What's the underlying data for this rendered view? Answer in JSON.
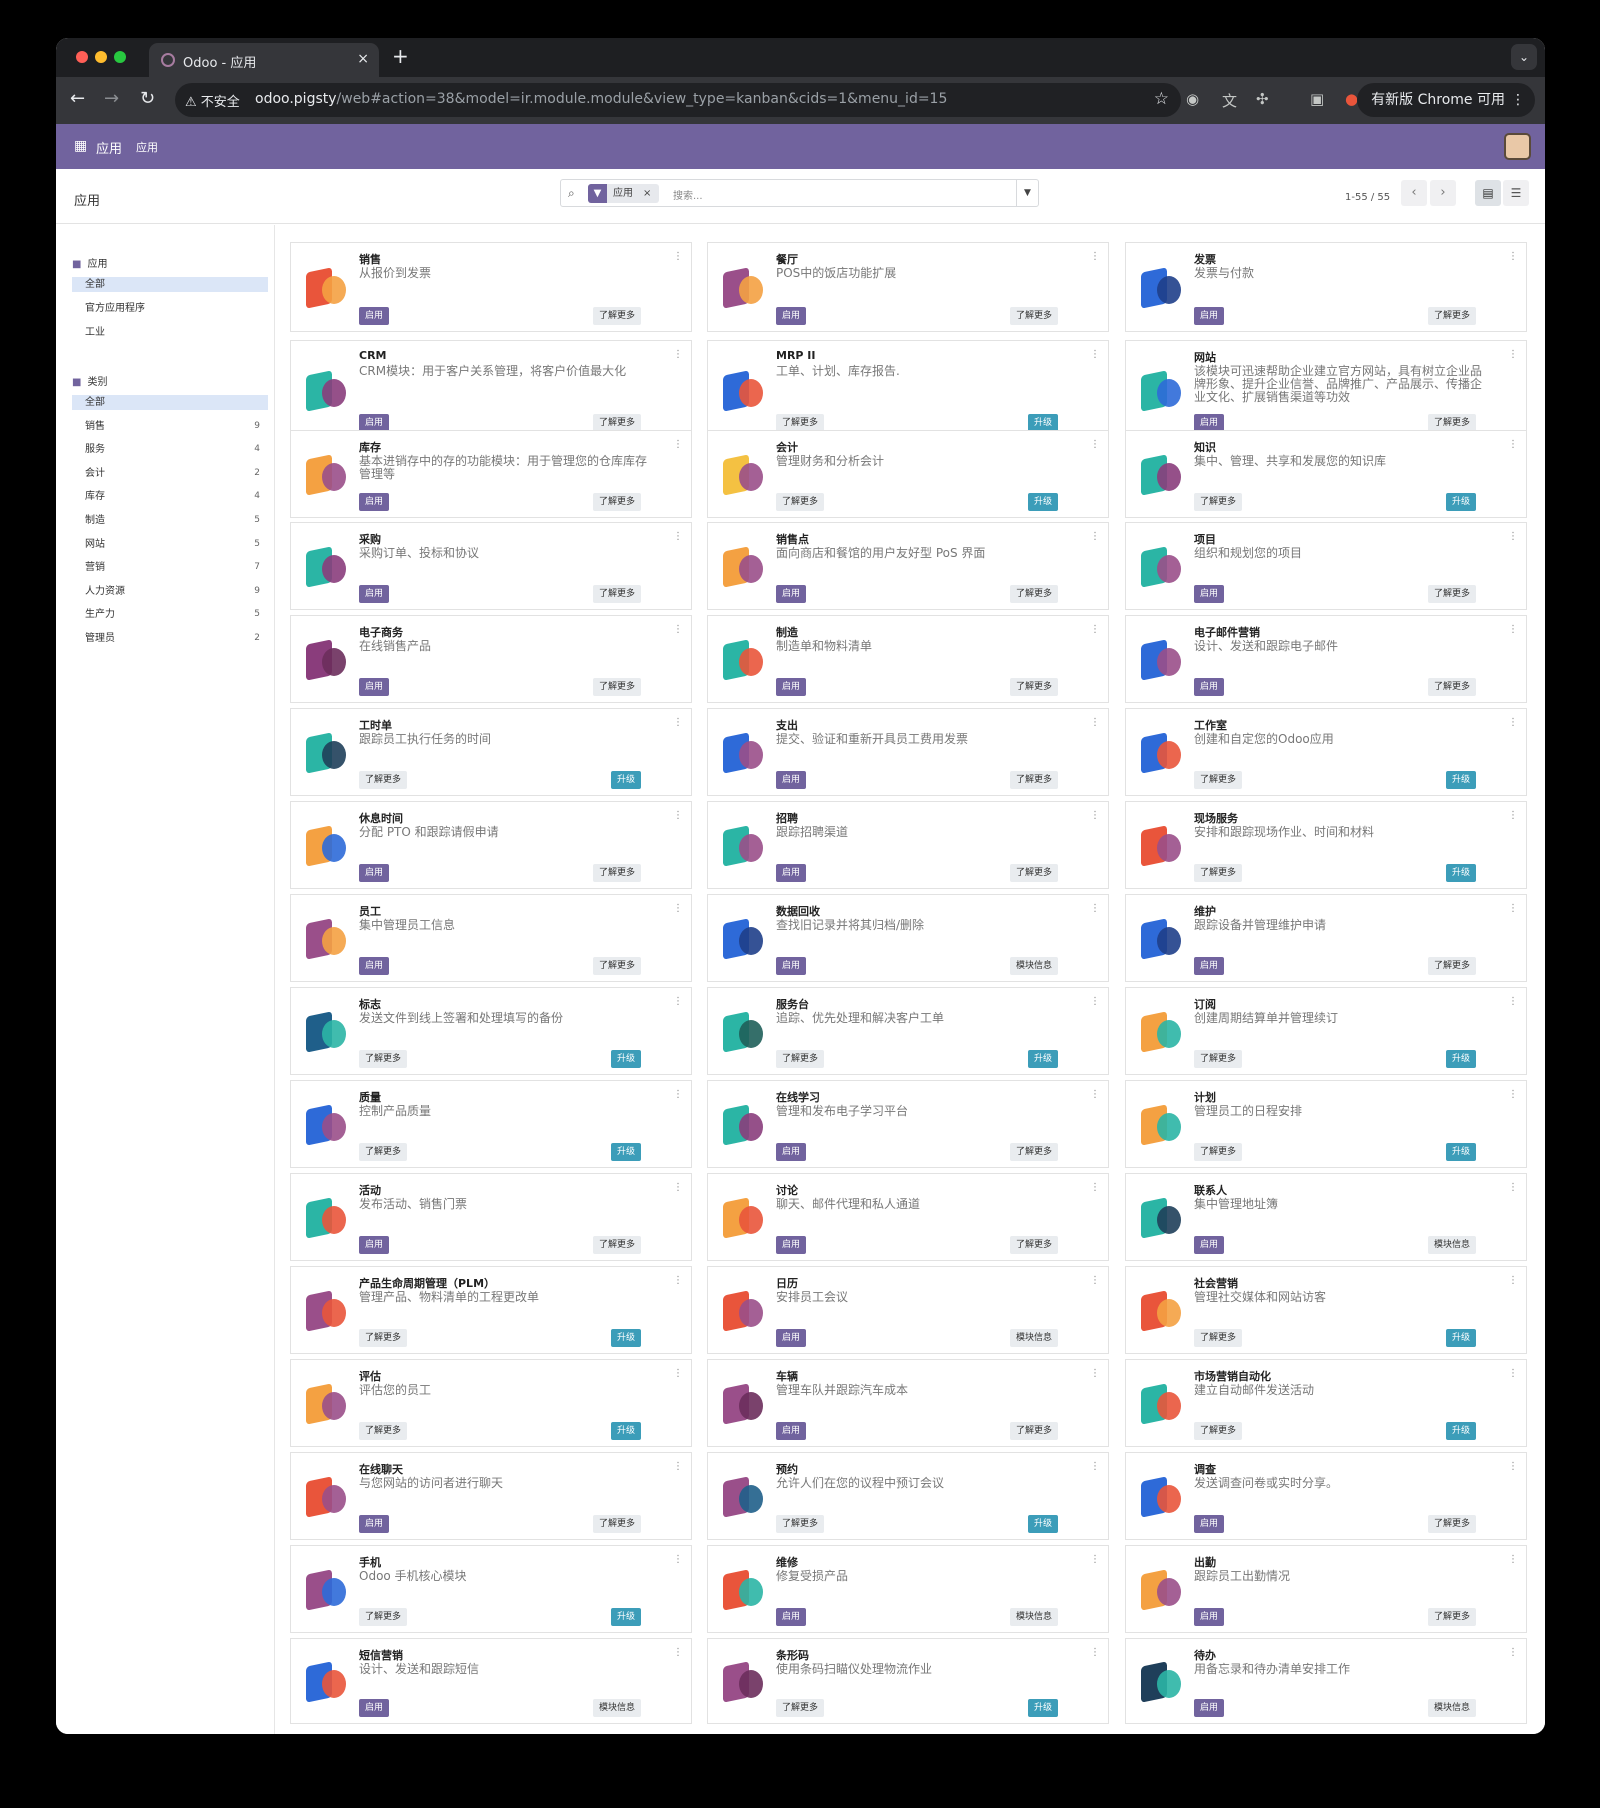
{
  "browser": {
    "tab_title": "Odoo - 应用",
    "tab_close": "×",
    "new_tab": "+",
    "security": "⚠ 不安全",
    "url_host": "odoo.pigsty",
    "url_path": "/web#action=38&model=ir.module.module&view_type=kanban&cids=1&menu_id=15",
    "update_label": "有新版 Chrome 可用",
    "colors": {
      "close": "#ff5f57",
      "min": "#febc2e",
      "max": "#28c840"
    }
  },
  "odoo_nav": {
    "brand": "应用",
    "menu": "应用"
  },
  "control_panel": {
    "title": "应用",
    "facet": "应用",
    "facet_close": "×",
    "search_placeholder": "搜索...",
    "pager": "1-55 / 55"
  },
  "sidebar": {
    "section1": "应用",
    "apps": [
      {
        "label": "全部",
        "selected": true
      },
      {
        "label": "官方应用程序",
        "selected": false
      },
      {
        "label": "工业",
        "selected": false
      }
    ],
    "section2": "类别",
    "categories": [
      {
        "label": "全部",
        "count": "",
        "selected": true
      },
      {
        "label": "销售",
        "count": "9"
      },
      {
        "label": "服务",
        "count": "4"
      },
      {
        "label": "会计",
        "count": "2"
      },
      {
        "label": "库存",
        "count": "4"
      },
      {
        "label": "制造",
        "count": "5"
      },
      {
        "label": "网站",
        "count": "5"
      },
      {
        "label": "营销",
        "count": "7"
      },
      {
        "label": "人力资源",
        "count": "9"
      },
      {
        "label": "生产力",
        "count": "5"
      },
      {
        "label": "管理员",
        "count": "2"
      }
    ]
  },
  "labels": {
    "activate": "启用",
    "learn": "了解更多",
    "upgrade": "升级",
    "info": "模块信息"
  },
  "apps": [
    {
      "name": "销售",
      "desc": "从报价到发票",
      "b1": "activate",
      "b2": "learn",
      "icon": "sales-icon",
      "c1": "#e9553b",
      "c2": "#f4a142"
    },
    {
      "name": "餐厅",
      "desc": "POS中的饭店功能扩展",
      "b1": "activate",
      "b2": "learn",
      "icon": "restaurant-icon",
      "c1": "#9a4f8a",
      "c2": "#f4a142"
    },
    {
      "name": "发票",
      "desc": "发票与付款",
      "b1": "activate",
      "b2": "learn",
      "icon": "invoicing-icon",
      "c1": "#2e6ad8",
      "c2": "#1f3f8a"
    },
    {
      "name": "CRM",
      "desc": "CRM模块：用于客户关系管理，将客户价值最大化",
      "b1": "activate",
      "b2": "learn",
      "icon": "crm-icon",
      "c1": "#2bb5a5",
      "c2": "#8a3d7c"
    },
    {
      "name": "MRP II",
      "desc": "工单、计划、库存报告.",
      "b1": "learn",
      "b2": "upgrade",
      "icon": "mrp-icon",
      "c1": "#2e6ad8",
      "c2": "#e9553b"
    },
    {
      "name": "网站",
      "desc": "该模块可迅速帮助企业建立官方网站，具有树立企业品牌形象、提升企业信誉、品牌推广、产品展示、传播企业文化、扩展销售渠道等功效",
      "b1": "activate",
      "b2": "learn",
      "icon": "website-icon",
      "c1": "#2bb5a5",
      "c2": "#2e6ad8"
    },
    {
      "name": "库存",
      "desc": "基本进销存中的存的功能模块：用于管理您的仓库库存管理等",
      "b1": "activate",
      "b2": "learn",
      "icon": "inventory-icon",
      "c1": "#f4a142",
      "c2": "#9a4f8a"
    },
    {
      "name": "会计",
      "desc": "管理财务和分析会计",
      "b1": "learn",
      "b2": "upgrade",
      "icon": "accounting-icon",
      "c1": "#f4c142",
      "c2": "#9a4f8a"
    },
    {
      "name": "知识",
      "desc": "集中、管理、共享和发展您的知识库",
      "b1": "learn",
      "b2": "upgrade",
      "icon": "knowledge-icon",
      "c1": "#2bb5a5",
      "c2": "#8a3d7c"
    },
    {
      "name": "采购",
      "desc": "采购订单、投标和协议",
      "b1": "activate",
      "b2": "learn",
      "icon": "purchase-icon",
      "c1": "#2bb5a5",
      "c2": "#8a3d7c"
    },
    {
      "name": "销售点",
      "desc": "面向商店和餐馆的用户友好型 PoS 界面",
      "b1": "activate",
      "b2": "learn",
      "icon": "pos-icon",
      "c1": "#f4a142",
      "c2": "#9a4f8a"
    },
    {
      "name": "项目",
      "desc": "组织和规划您的项目",
      "b1": "activate",
      "b2": "learn",
      "icon": "project-icon",
      "c1": "#2bb5a5",
      "c2": "#9a4f8a"
    },
    {
      "name": "电子商务",
      "desc": "在线销售产品",
      "b1": "activate",
      "b2": "learn",
      "icon": "ecommerce-icon",
      "c1": "#8a3d7c",
      "c2": "#6b2d5c"
    },
    {
      "name": "制造",
      "desc": "制造单和物料清单",
      "b1": "activate",
      "b2": "learn",
      "icon": "manufacturing-icon",
      "c1": "#2bb5a5",
      "c2": "#e9553b"
    },
    {
      "name": "电子邮件营销",
      "desc": "设计、发送和跟踪电子邮件",
      "b1": "activate",
      "b2": "learn",
      "icon": "email-marketing-icon",
      "c1": "#2e6ad8",
      "c2": "#9a4f8a"
    },
    {
      "name": "工时单",
      "desc": "跟踪员工执行任务的时间",
      "b1": "learn",
      "b2": "upgrade",
      "icon": "timesheet-icon",
      "c1": "#2bb5a5",
      "c2": "#1f3f5a"
    },
    {
      "name": "支出",
      "desc": "提交、验证和重新开具员工费用发票",
      "b1": "activate",
      "b2": "learn",
      "icon": "expenses-icon",
      "c1": "#2e6ad8",
      "c2": "#9a4f8a"
    },
    {
      "name": "工作室",
      "desc": "创建和自定您的Odoo应用",
      "b1": "learn",
      "b2": "upgrade",
      "icon": "studio-icon",
      "c1": "#2e6ad8",
      "c2": "#e9553b"
    },
    {
      "name": "休息时间",
      "desc": "分配 PTO 和跟踪请假申请",
      "b1": "activate",
      "b2": "learn",
      "icon": "time-off-icon",
      "c1": "#f4a142",
      "c2": "#2e6ad8"
    },
    {
      "name": "招聘",
      "desc": "跟踪招聘渠道",
      "b1": "activate",
      "b2": "learn",
      "icon": "recruitment-icon",
      "c1": "#2bb5a5",
      "c2": "#9a4f8a"
    },
    {
      "name": "现场服务",
      "desc": "安排和跟踪现场作业、时间和材料",
      "b1": "learn",
      "b2": "upgrade",
      "icon": "field-service-icon",
      "c1": "#e9553b",
      "c2": "#9a4f8a"
    },
    {
      "name": "员工",
      "desc": "集中管理员工信息",
      "b1": "activate",
      "b2": "learn",
      "icon": "employees-icon",
      "c1": "#9a4f8a",
      "c2": "#f4a142"
    },
    {
      "name": "数据回收",
      "desc": "查找旧记录并将其归档/删除",
      "b1": "activate",
      "b2": "info",
      "icon": "data-recycle-icon",
      "c1": "#2e6ad8",
      "c2": "#1f3f8a"
    },
    {
      "name": "维护",
      "desc": "跟踪设备并管理维护申请",
      "b1": "activate",
      "b2": "learn",
      "icon": "maintenance-icon",
      "c1": "#2e6ad8",
      "c2": "#1f3f8a"
    },
    {
      "name": "标志",
      "desc": "发送文件到线上签署和处理填写的备份",
      "b1": "learn",
      "b2": "upgrade",
      "icon": "sign-icon",
      "c1": "#1f5f8a",
      "c2": "#2bb5a5"
    },
    {
      "name": "服务台",
      "desc": "追踪、优先处理和解决客户工单",
      "b1": "learn",
      "b2": "upgrade",
      "icon": "helpdesk-icon",
      "c1": "#2bb5a5",
      "c2": "#1f5f5a"
    },
    {
      "name": "订阅",
      "desc": "创建周期结算单并管理续订",
      "b1": "learn",
      "b2": "upgrade",
      "icon": "subscription-icon",
      "c1": "#f4a142",
      "c2": "#2bb5a5"
    },
    {
      "name": "质量",
      "desc": "控制产品质量",
      "b1": "learn",
      "b2": "upgrade",
      "icon": "quality-icon",
      "c1": "#2e6ad8",
      "c2": "#9a4f8a"
    },
    {
      "name": "在线学习",
      "desc": "管理和发布电子学习平台",
      "b1": "activate",
      "b2": "learn",
      "icon": "elearning-icon",
      "c1": "#2bb5a5",
      "c2": "#8a3d7c"
    },
    {
      "name": "计划",
      "desc": "管理员工的日程安排",
      "b1": "learn",
      "b2": "upgrade",
      "icon": "planning-icon",
      "c1": "#f4a142",
      "c2": "#2bb5a5"
    },
    {
      "name": "活动",
      "desc": "发布活动、销售门票",
      "b1": "activate",
      "b2": "learn",
      "icon": "events-icon",
      "c1": "#2bb5a5",
      "c2": "#e9553b"
    },
    {
      "name": "讨论",
      "desc": "聊天、邮件代理和私人通道",
      "b1": "activate",
      "b2": "learn",
      "icon": "discuss-icon",
      "c1": "#f4a142",
      "c2": "#e9553b"
    },
    {
      "name": "联系人",
      "desc": "集中管理地址簿",
      "b1": "activate",
      "b2": "info",
      "icon": "contacts-icon",
      "c1": "#2bb5a5",
      "c2": "#1f3f5a"
    },
    {
      "name": "产品生命周期管理（PLM）",
      "desc": "管理产品、物料清单的工程更改单",
      "b1": "learn",
      "b2": "upgrade",
      "icon": "plm-icon",
      "c1": "#9a4f8a",
      "c2": "#e9553b"
    },
    {
      "name": "日历",
      "desc": "安排员工会议",
      "b1": "activate",
      "b2": "info",
      "icon": "calendar-icon",
      "c1": "#e9553b",
      "c2": "#9a4f8a"
    },
    {
      "name": "社会营销",
      "desc": "管理社交媒体和网站访客",
      "b1": "learn",
      "b2": "upgrade",
      "icon": "social-marketing-icon",
      "c1": "#e9553b",
      "c2": "#f4a142"
    },
    {
      "name": "评估",
      "desc": "评估您的员工",
      "b1": "learn",
      "b2": "upgrade",
      "icon": "appraisal-icon",
      "c1": "#f4a142",
      "c2": "#9a4f8a"
    },
    {
      "name": "车辆",
      "desc": "管理车队并跟踪汽车成本",
      "b1": "activate",
      "b2": "learn",
      "icon": "fleet-icon",
      "c1": "#9a4f8a",
      "c2": "#6b2d5c"
    },
    {
      "name": "市场营销自动化",
      "desc": "建立自动邮件发送活动",
      "b1": "learn",
      "b2": "upgrade",
      "icon": "marketing-automation-icon",
      "c1": "#2bb5a5",
      "c2": "#e9553b"
    },
    {
      "name": "在线聊天",
      "desc": "与您网站的访问者进行聊天",
      "b1": "activate",
      "b2": "learn",
      "icon": "livechat-icon",
      "c1": "#e9553b",
      "c2": "#9a4f8a"
    },
    {
      "name": "预约",
      "desc": "允许人们在您的议程中预订会议",
      "b1": "learn",
      "b2": "upgrade",
      "icon": "appointment-icon",
      "c1": "#9a4f8a",
      "c2": "#1f5f8a"
    },
    {
      "name": "调查",
      "desc": "发送调查问卷或实时分享。",
      "b1": "activate",
      "b2": "learn",
      "icon": "surveys-icon",
      "c1": "#2e6ad8",
      "c2": "#e9553b"
    },
    {
      "name": "手机",
      "desc": "Odoo 手机核心模块",
      "b1": "learn",
      "b2": "upgrade",
      "icon": "mobile-icon",
      "c1": "#9a4f8a",
      "c2": "#2e6ad8"
    },
    {
      "name": "维修",
      "desc": "修复受损产品",
      "b1": "activate",
      "b2": "info",
      "icon": "repairs-icon",
      "c1": "#e9553b",
      "c2": "#2bb5a5"
    },
    {
      "name": "出勤",
      "desc": "跟踪员工出勤情况",
      "b1": "activate",
      "b2": "learn",
      "icon": "attendances-icon",
      "c1": "#f4a142",
      "c2": "#9a4f8a"
    },
    {
      "name": "短信营销",
      "desc": "设计、发送和跟踪短信",
      "b1": "activate",
      "b2": "info",
      "icon": "sms-marketing-icon",
      "c1": "#2e6ad8",
      "c2": "#e9553b"
    },
    {
      "name": "条形码",
      "desc": "使用条码扫瞄仪处理物流作业",
      "b1": "learn",
      "b2": "upgrade",
      "icon": "barcode-icon",
      "c1": "#9a4f8a",
      "c2": "#6b2d5c"
    },
    {
      "name": "待办",
      "desc": "用备忘录和待办清单安排工作",
      "b1": "activate",
      "b2": "info",
      "icon": "todo-icon",
      "c1": "#1f3f5a",
      "c2": "#2bb5a5"
    }
  ]
}
